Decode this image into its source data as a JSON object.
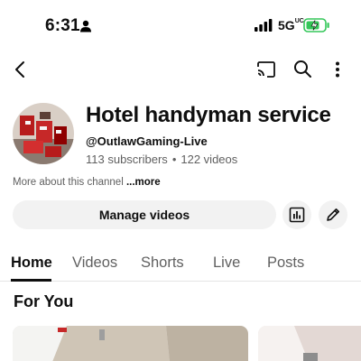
{
  "status_bar": {
    "time": "6:31",
    "network": "5G",
    "network_suffix": "UC",
    "battery_color": "#34c759"
  },
  "app_bar": {
    "icons": [
      "back-icon",
      "cast-icon",
      "search-icon",
      "more-vert-icon"
    ]
  },
  "channel": {
    "name": "Hotel handyman service",
    "handle": "@OutlawGaming-Live",
    "subscribers": "113 subscribers",
    "separator": "•",
    "videos": "122 videos",
    "about": "More about this channel",
    "about_more": "...more"
  },
  "actions": {
    "manage_label": "Manage videos",
    "icons": [
      "analytics-icon",
      "edit-icon"
    ]
  },
  "tabs": [
    {
      "label": "Home",
      "active": true
    },
    {
      "label": "Videos",
      "active": false
    },
    {
      "label": "Shorts",
      "active": false
    },
    {
      "label": "Live",
      "active": false
    },
    {
      "label": "Posts",
      "active": false
    }
  ],
  "section": {
    "title": "For You"
  }
}
